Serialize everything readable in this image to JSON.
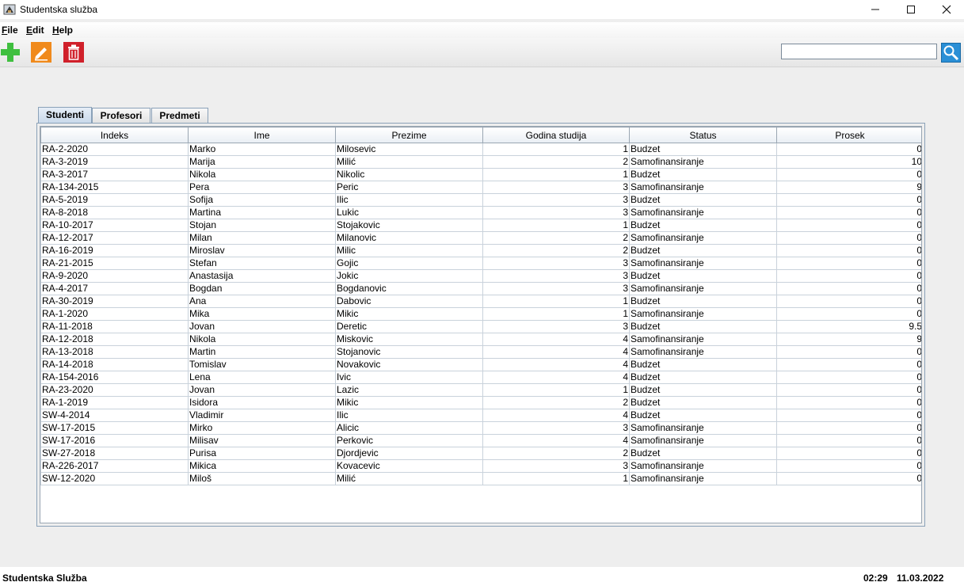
{
  "window": {
    "title": "Studentska služba",
    "icon": "java-app-icon",
    "controls": [
      "minimize",
      "maximize",
      "close"
    ]
  },
  "menu": {
    "file": "File",
    "edit": "Edit",
    "help": "Help"
  },
  "toolbar": {
    "add_icon": "plus-icon",
    "edit_icon": "pencil-icon",
    "delete_icon": "trash-icon",
    "search_value": "",
    "search_icon": "magnifier-icon"
  },
  "tabs": [
    {
      "label": "Studenti",
      "active": true
    },
    {
      "label": "Profesori",
      "active": false
    },
    {
      "label": "Predmeti",
      "active": false
    }
  ],
  "table": {
    "columns": [
      "Indeks",
      "Ime",
      "Prezime",
      "Godina studija",
      "Status",
      "Prosek"
    ],
    "rows": [
      [
        "RA-2-2020",
        "Marko",
        "Milosevic",
        "1",
        "Budzet",
        "0"
      ],
      [
        "RA-3-2019",
        "Marija",
        "Milić",
        "2",
        "Samofinansiranje",
        "10"
      ],
      [
        "RA-3-2017",
        "Nikola",
        "Nikolic",
        "1",
        "Budzet",
        "0"
      ],
      [
        "RA-134-2015",
        "Pera",
        "Peric",
        "3",
        "Samofinansiranje",
        "9"
      ],
      [
        "RA-5-2019",
        "Sofija",
        "Ilic",
        "3",
        "Budzet",
        "0"
      ],
      [
        "RA-8-2018",
        "Martina",
        "Lukic",
        "3",
        "Samofinansiranje",
        "0"
      ],
      [
        "RA-10-2017",
        "Stojan",
        "Stojakovic",
        "1",
        "Budzet",
        "0"
      ],
      [
        "RA-12-2017",
        "Milan",
        "Milanovic",
        "2",
        "Samofinansiranje",
        "0"
      ],
      [
        "RA-16-2019",
        "Miroslav",
        "Milic",
        "2",
        "Budzet",
        "0"
      ],
      [
        "RA-21-2015",
        "Stefan",
        "Gojic",
        "3",
        "Samofinansiranje",
        "0"
      ],
      [
        "RA-9-2020",
        "Anastasija",
        "Jokic",
        "3",
        "Budzet",
        "0"
      ],
      [
        "RA-4-2017",
        "Bogdan",
        "Bogdanovic",
        "3",
        "Samofinansiranje",
        "0"
      ],
      [
        "RA-30-2019",
        "Ana",
        "Dabovic",
        "1",
        "Budzet",
        "0"
      ],
      [
        "RA-1-2020",
        "Mika",
        "Mikic",
        "1",
        "Samofinansiranje",
        "0"
      ],
      [
        "RA-11-2018",
        "Jovan",
        "Deretic",
        "3",
        "Budzet",
        "9.5"
      ],
      [
        "RA-12-2018",
        "Nikola",
        "Miskovic",
        "4",
        "Samofinansiranje",
        "9"
      ],
      [
        "RA-13-2018",
        "Martin",
        "Stojanovic",
        "4",
        "Samofinansiranje",
        "0"
      ],
      [
        "RA-14-2018",
        "Tomislav",
        "Novakovic",
        "4",
        "Budzet",
        "0"
      ],
      [
        "RA-154-2016",
        "Lena",
        "Ivic",
        "4",
        "Budzet",
        "0"
      ],
      [
        "RA-23-2020",
        "Jovan",
        "Lazic",
        "1",
        "Budzet",
        "0"
      ],
      [
        "RA-1-2019",
        "Isidora",
        "Mikic",
        "2",
        "Budzet",
        "0"
      ],
      [
        "SW-4-2014",
        "Vladimir",
        "Ilic",
        "4",
        "Budzet",
        "0"
      ],
      [
        "SW-17-2015",
        "Mirko",
        "Alicic",
        "3",
        "Samofinansiranje",
        "0"
      ],
      [
        "SW-17-2016",
        "Milisav",
        "Perkovic",
        "4",
        "Samofinansiranje",
        "0"
      ],
      [
        "SW-27-2018",
        "Purisa",
        "Djordjevic",
        "2",
        "Budzet",
        "0"
      ],
      [
        "RA-226-2017",
        "Mikica",
        "Kovacevic",
        "3",
        "Samofinansiranje",
        "0"
      ],
      [
        "SW-12-2020",
        "Miloš",
        "Milić",
        "1",
        "Samofinansiranje",
        "0"
      ]
    ]
  },
  "statusbar": {
    "app_name": "Studentska Služba",
    "time": "02:29",
    "date": "11.03.2022"
  },
  "colors": {
    "add": "#3fbf3f",
    "edit": "#f08a1c",
    "delete": "#d0202a",
    "search": "#2a8fd6"
  }
}
